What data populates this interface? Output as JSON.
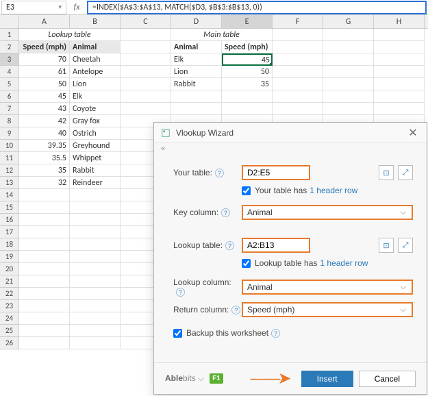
{
  "name_box": "E3",
  "fx_label": "fx",
  "formula": "=INDEX($A$3:$A$13, MATCH($D3, $B$3:$B$13, 0))",
  "columns": [
    "A",
    "B",
    "C",
    "D",
    "E",
    "F",
    "G",
    "H"
  ],
  "lookup_title": "Lookup table",
  "main_title": "Main table",
  "headers": {
    "speed": "Speed (mph)",
    "animal": "Animal"
  },
  "lookup_rows": [
    {
      "speed": "70",
      "animal": "Cheetah"
    },
    {
      "speed": "61",
      "animal": "Antelope"
    },
    {
      "speed": "50",
      "animal": "Lion"
    },
    {
      "speed": "45",
      "animal": "Elk"
    },
    {
      "speed": "43",
      "animal": "Coyote"
    },
    {
      "speed": "42",
      "animal": "Gray fox"
    },
    {
      "speed": "40",
      "animal": "Ostrich"
    },
    {
      "speed": "39.35",
      "animal": "Greyhound"
    },
    {
      "speed": "35.5",
      "animal": "Whippet"
    },
    {
      "speed": "35",
      "animal": "Rabbit"
    },
    {
      "speed": "32",
      "animal": "Reindeer"
    }
  ],
  "main_rows": [
    {
      "animal": "Elk",
      "speed": "45"
    },
    {
      "animal": "Lion",
      "speed": "50"
    },
    {
      "animal": "Rabbit",
      "speed": "35"
    }
  ],
  "dialog": {
    "title": "Vlookup Wizard",
    "your_table_label": "Your table:",
    "your_table_value": "D2:E5",
    "your_table_has": "Your table has",
    "header_row_link": "1 header row",
    "key_column_label": "Key column:",
    "key_column_value": "Animal",
    "lookup_table_label": "Lookup table:",
    "lookup_table_value": "A2:B13",
    "lookup_table_has": "Lookup table has",
    "lookup_column_label": "Lookup column:",
    "lookup_column_value": "Animal",
    "return_column_label": "Return column:",
    "return_column_value": "Speed (mph)",
    "backup_label": "Backup this worksheet",
    "brand_pre": "Able",
    "brand_post": "bits",
    "help_badge": "F1",
    "insert_btn": "Insert",
    "cancel_btn": "Cancel",
    "collapse": "«"
  }
}
